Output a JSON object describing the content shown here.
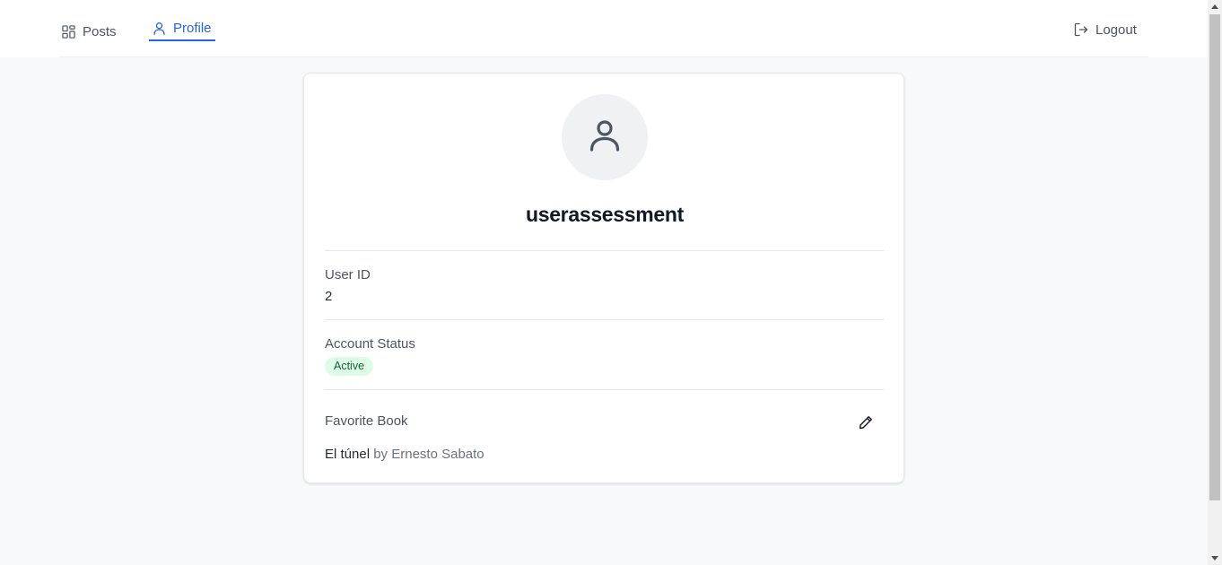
{
  "nav": {
    "posts_label": "Posts",
    "profile_label": "Profile",
    "logout_label": "Logout",
    "active_tab": "profile",
    "accent_color": "#2563eb"
  },
  "profile": {
    "username": "userassessment",
    "user_id_label": "User ID",
    "user_id_value": "2",
    "account_status_label": "Account Status",
    "account_status_value": "Active",
    "favorite_book_label": "Favorite Book",
    "favorite_book_title": "El túnel",
    "favorite_book_author": "by Ernesto Sabato"
  },
  "icons": {
    "posts": "grid-icon",
    "profile": "user-icon",
    "logout": "logout-icon",
    "avatar": "user-icon",
    "edit": "pencil-icon"
  },
  "colors": {
    "status_badge_bg": "#dcfce7",
    "status_badge_text": "#166534"
  }
}
